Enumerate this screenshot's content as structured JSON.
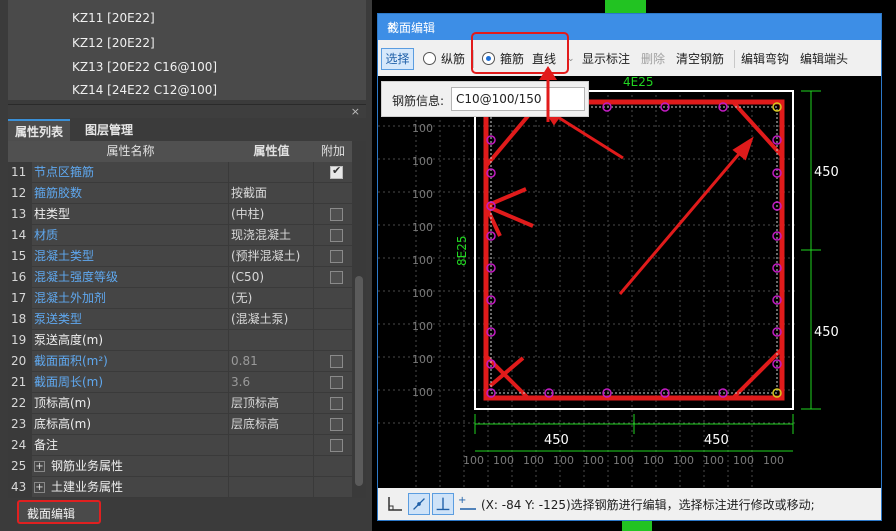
{
  "component_list": [
    "KZ11 [20E22]",
    "KZ12 [20E22]",
    "KZ13 [20E22 C16@100]",
    "KZ14 [24E22 C12@100]"
  ],
  "splitter": {
    "close_glyph": "×"
  },
  "property_tabs": [
    "属性列表",
    "图层管理"
  ],
  "property_header": {
    "name": "属性名称",
    "value": "属性值",
    "extra": "附加"
  },
  "properties": [
    {
      "num": "11",
      "name": "节点区箍筋",
      "value": "",
      "color": "blue",
      "checkbox": "checked"
    },
    {
      "num": "12",
      "name": "箍筋胶数",
      "value": "按截面",
      "color": "blue",
      "checkbox": "none"
    },
    {
      "num": "13",
      "name": "柱类型",
      "value": "(中柱)",
      "color": "white",
      "checkbox": "empty"
    },
    {
      "num": "14",
      "name": "材质",
      "value": "现浇混凝土",
      "color": "blue",
      "checkbox": "empty"
    },
    {
      "num": "15",
      "name": "混凝土类型",
      "value": "(预拌混凝土)",
      "color": "blue",
      "checkbox": "empty"
    },
    {
      "num": "16",
      "name": "混凝土强度等级",
      "value": "(C50)",
      "color": "blue",
      "checkbox": "empty"
    },
    {
      "num": "17",
      "name": "混凝土外加剂",
      "value": "(无)",
      "color": "blue",
      "checkbox": "none"
    },
    {
      "num": "18",
      "name": "泵送类型",
      "value": "(混凝土泵)",
      "color": "blue",
      "checkbox": "none"
    },
    {
      "num": "19",
      "name": "泵送高度(m)",
      "value": "",
      "color": "white",
      "checkbox": "none"
    },
    {
      "num": "20",
      "name": "截面面积(m²)",
      "value": "0.81",
      "color": "blue",
      "checkbox": "empty",
      "value_gray": true
    },
    {
      "num": "21",
      "name": "截面周长(m)",
      "value": "3.6",
      "color": "blue",
      "checkbox": "empty",
      "value_gray": true
    },
    {
      "num": "22",
      "name": "顶标高(m)",
      "value": "层顶标高",
      "color": "white",
      "checkbox": "empty"
    },
    {
      "num": "23",
      "name": "底标高(m)",
      "value": "层底标高",
      "color": "white",
      "checkbox": "empty"
    },
    {
      "num": "24",
      "name": "备注",
      "value": "",
      "color": "white",
      "checkbox": "empty"
    },
    {
      "num": "25",
      "name": "钢筋业务属性",
      "value": "",
      "color": "white",
      "checkbox": "none",
      "expander": "+"
    },
    {
      "num": "43",
      "name": "土建业务属性",
      "value": "",
      "color": "white",
      "checkbox": "none",
      "expander": "+"
    }
  ],
  "section_edit_button": "截面编辑",
  "dialog": {
    "title": "截面编辑",
    "close_glyph": "×",
    "toolbar": {
      "select": "选择",
      "longitudinal": "纵筋",
      "stirrup": "箍筋",
      "line_mode": "直线",
      "show_annotation": "显示标注",
      "delete": "删除",
      "clear_rebar": "清空钢筋",
      "edit_hook": "编辑弯钩",
      "edit_end": "编辑端头"
    },
    "rebar_info": {
      "label": "钢筋信息:",
      "value": "C10@100/150"
    },
    "drawing": {
      "top_label": "4E25",
      "side_label": "8E25",
      "dim_right_top": "450",
      "dim_right_bottom": "450",
      "dim_bottom_left": "450",
      "dim_bottom_right": "450",
      "grid_label": "100"
    },
    "status_text": "(X: -84 Y: -125)选择钢筋进行编辑，选择标注进行修改或移动;"
  },
  "colors": {
    "accent": "#3d8ee6",
    "highlight": "#e21b1b",
    "rebar": "#e01b1b",
    "dimension": "#21d521",
    "circle": "#c21bc2"
  }
}
